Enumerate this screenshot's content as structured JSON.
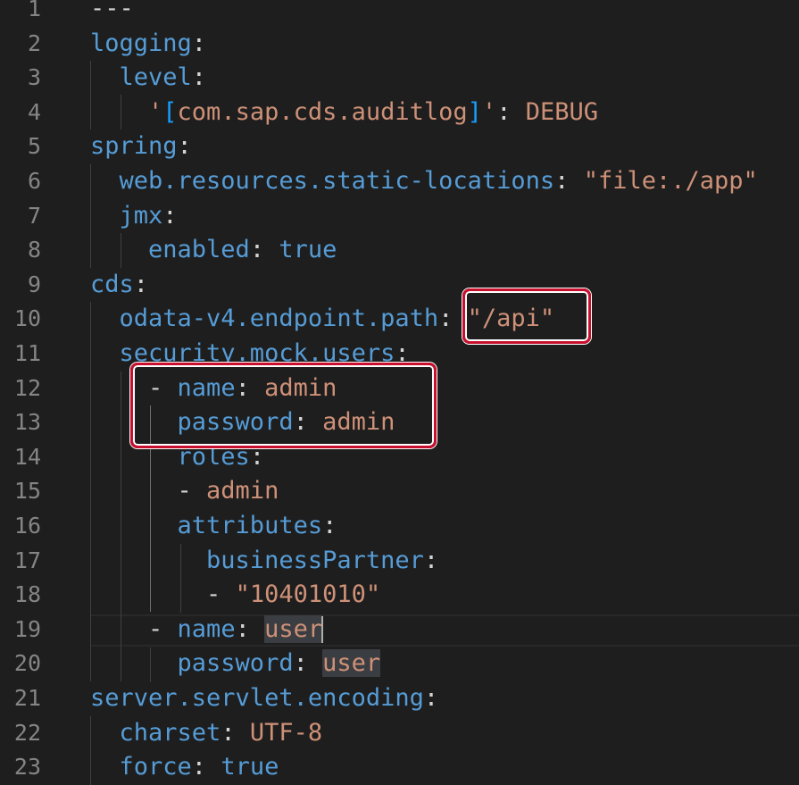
{
  "editor": {
    "language": "yaml",
    "lines": [
      {
        "n": "1",
        "tokens": [
          {
            "t": "---",
            "c": "p"
          }
        ]
      },
      {
        "n": "2",
        "tokens": [
          {
            "t": "logging",
            "c": "k"
          },
          {
            "t": ":",
            "c": "p"
          }
        ]
      },
      {
        "n": "3",
        "tokens": [
          {
            "t": "  level",
            "c": "k"
          },
          {
            "t": ":",
            "c": "p"
          }
        ]
      },
      {
        "n": "4",
        "tokens": [
          {
            "t": "    '",
            "c": "s"
          },
          {
            "t": "[",
            "c": "b"
          },
          {
            "t": "com.sap.cds.auditlog",
            "c": "s"
          },
          {
            "t": "]",
            "c": "b"
          },
          {
            "t": "'",
            "c": "s"
          },
          {
            "t": ": ",
            "c": "p"
          },
          {
            "t": "DEBUG",
            "c": "s"
          }
        ]
      },
      {
        "n": "5",
        "tokens": [
          {
            "t": "spring",
            "c": "k"
          },
          {
            "t": ":",
            "c": "p"
          }
        ]
      },
      {
        "n": "6",
        "tokens": [
          {
            "t": "  web.resources.static-locations",
            "c": "k"
          },
          {
            "t": ": ",
            "c": "p"
          },
          {
            "t": "\"file:./app\"",
            "c": "s"
          }
        ]
      },
      {
        "n": "7",
        "tokens": [
          {
            "t": "  jmx",
            "c": "k"
          },
          {
            "t": ":",
            "c": "p"
          }
        ]
      },
      {
        "n": "8",
        "tokens": [
          {
            "t": "    enabled",
            "c": "k"
          },
          {
            "t": ": ",
            "c": "p"
          },
          {
            "t": "true",
            "c": "k"
          }
        ]
      },
      {
        "n": "9",
        "tokens": [
          {
            "t": "cds",
            "c": "k"
          },
          {
            "t": ":",
            "c": "p"
          }
        ]
      },
      {
        "n": "10",
        "tokens": [
          {
            "t": "  odata-v4.endpoint.path",
            "c": "k"
          },
          {
            "t": ": ",
            "c": "p"
          },
          {
            "t": "\"/api\"",
            "c": "s"
          }
        ]
      },
      {
        "n": "11",
        "tokens": [
          {
            "t": "  security.mock.users",
            "c": "k"
          },
          {
            "t": ":",
            "c": "p"
          }
        ]
      },
      {
        "n": "12",
        "tokens": [
          {
            "t": "    - ",
            "c": "p"
          },
          {
            "t": "name",
            "c": "k"
          },
          {
            "t": ": ",
            "c": "p"
          },
          {
            "t": "admin",
            "c": "s"
          }
        ]
      },
      {
        "n": "13",
        "tokens": [
          {
            "t": "      password",
            "c": "k"
          },
          {
            "t": ": ",
            "c": "p"
          },
          {
            "t": "admin",
            "c": "s"
          }
        ]
      },
      {
        "n": "14",
        "tokens": [
          {
            "t": "      roles",
            "c": "k"
          },
          {
            "t": ":",
            "c": "p"
          }
        ]
      },
      {
        "n": "15",
        "tokens": [
          {
            "t": "      - ",
            "c": "p"
          },
          {
            "t": "admin",
            "c": "s"
          }
        ]
      },
      {
        "n": "16",
        "tokens": [
          {
            "t": "      attributes",
            "c": "k"
          },
          {
            "t": ":",
            "c": "p"
          }
        ]
      },
      {
        "n": "17",
        "tokens": [
          {
            "t": "        businessPartner",
            "c": "k"
          },
          {
            "t": ":",
            "c": "p"
          }
        ]
      },
      {
        "n": "18",
        "tokens": [
          {
            "t": "        - ",
            "c": "p"
          },
          {
            "t": "\"10401010\"",
            "c": "s"
          }
        ]
      },
      {
        "n": "19",
        "tokens": [
          {
            "t": "    - ",
            "c": "p"
          },
          {
            "t": "name",
            "c": "k"
          },
          {
            "t": ": ",
            "c": "p"
          },
          {
            "t": "user",
            "c": "s",
            "hl": true,
            "cursor": true
          }
        ]
      },
      {
        "n": "20",
        "tokens": [
          {
            "t": "      password",
            "c": "k"
          },
          {
            "t": ": ",
            "c": "p"
          },
          {
            "t": "user",
            "c": "s",
            "hl": true
          }
        ]
      },
      {
        "n": "21",
        "tokens": [
          {
            "t": "server.servlet.encoding",
            "c": "k"
          },
          {
            "t": ":",
            "c": "p"
          }
        ]
      },
      {
        "n": "22",
        "tokens": [
          {
            "t": "  charset",
            "c": "k"
          },
          {
            "t": ": ",
            "c": "p"
          },
          {
            "t": "UTF-8",
            "c": "s"
          }
        ]
      },
      {
        "n": "23",
        "tokens": [
          {
            "t": "  force",
            "c": "k"
          },
          {
            "t": ": ",
            "c": "p"
          },
          {
            "t": "true",
            "c": "k"
          }
        ]
      }
    ]
  }
}
